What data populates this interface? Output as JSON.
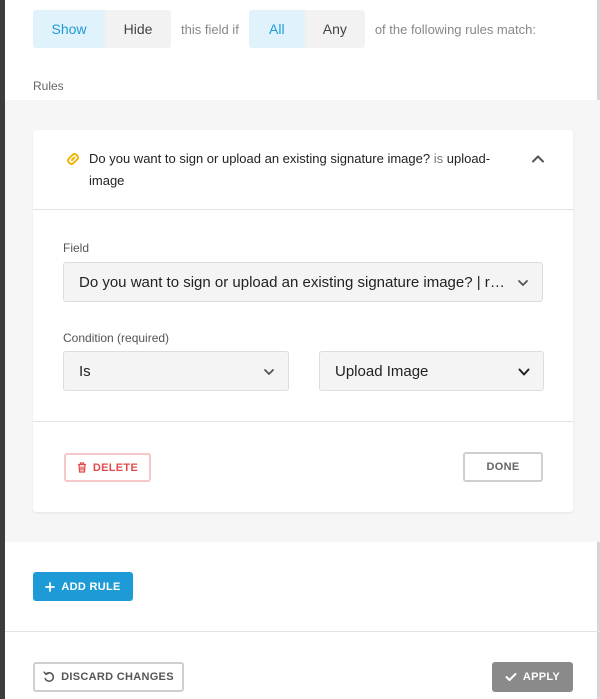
{
  "visibility": {
    "show_label": "Show",
    "hide_label": "Hide",
    "middle_text": "this field if",
    "all_label": "All",
    "any_label": "Any",
    "suffix_text": "of the following rules match:",
    "selected_visibility": "Show",
    "selected_match": "All"
  },
  "rules_label": "Rules",
  "rule": {
    "summary_field": "Do you want to sign or upload an existing signature image?",
    "summary_operator": "is",
    "summary_value": "upload-image",
    "field_label": "Field",
    "field_value": "Do you want to sign or upload an existing signature image? | radio...",
    "condition_label": "Condition (required)",
    "condition_value": "Is",
    "condition_target": "Upload Image",
    "delete_label": "DELETE",
    "done_label": "DONE"
  },
  "add_rule_label": "ADD RULE",
  "footer": {
    "discard_label": "DISCARD CHANGES",
    "apply_label": "APPLY"
  },
  "colors": {
    "accent": "#1e9bd7",
    "danger": "#e24b4b",
    "link_icon": "#f0b400",
    "apply_bg": "#8a8a8a"
  },
  "icons": {
    "rule": "link-icon",
    "collapse": "chevron-up-icon",
    "select": "chevron-down-icon",
    "delete": "trash-icon",
    "add": "plus-icon",
    "discard": "undo-icon",
    "apply": "check-icon"
  }
}
